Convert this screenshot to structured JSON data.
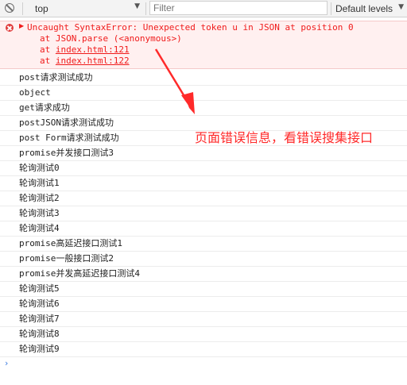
{
  "toolbar": {
    "context": "top",
    "filter_placeholder": "Filter",
    "levels": "Default levels"
  },
  "error": {
    "message": "Uncaught SyntaxError: Unexpected token u in JSON at position 0",
    "stack_at_1": "at JSON.parse (<anonymous>)",
    "stack_at_2_prefix": "at ",
    "stack_at_2_link": "index.html:121",
    "stack_at_3_prefix": "at ",
    "stack_at_3_link": "index.html:122"
  },
  "logs": [
    "post请求测试成功",
    "object",
    "get请求成功",
    "postJSON请求测试成功",
    "post Form请求测试成功",
    "promise并发接口测试3",
    "轮询测试0",
    "轮询测试1",
    "轮询测试2",
    "轮询测试3",
    "轮询测试4",
    "promise高延迟接口测试1",
    "promise一般接口测试2",
    "promise并发高延迟接口测试4",
    "轮询测试5",
    "轮询测试6",
    "轮询测试7",
    "轮询测试8",
    "轮询测试9"
  ],
  "prompt": "›",
  "annotation": "页面错误信息，看错误搜集接口",
  "colors": {
    "error_text": "#f01b1b",
    "error_bg": "#fff0f0",
    "annotation": "#ff2a2a",
    "prompt": "#3a7ae0"
  }
}
